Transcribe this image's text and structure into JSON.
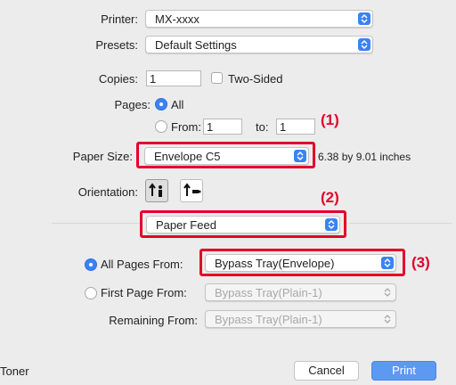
{
  "printer": {
    "label": "Printer:",
    "value": "MX-xxxx"
  },
  "presets": {
    "label": "Presets:",
    "value": "Default Settings"
  },
  "copies": {
    "label": "Copies:",
    "value": "1",
    "two_sided_label": "Two-Sided"
  },
  "pages": {
    "label": "Pages:",
    "all_label": "All",
    "from_label": "From:",
    "from_value": "1",
    "to_label": "to:",
    "to_value": "1"
  },
  "paper_size": {
    "label": "Paper Size:",
    "value": "Envelope C5",
    "dimensions": "6.38 by 9.01 inches"
  },
  "orientation": {
    "label": "Orientation:"
  },
  "section_menu": {
    "value": "Paper Feed"
  },
  "paper_feed": {
    "all_pages_label": "All Pages From:",
    "all_pages_value": "Bypass Tray(Envelope)",
    "first_page_label": "First Page From:",
    "first_page_value": "Bypass Tray(Plain-1)",
    "remaining_label": "Remaining From:",
    "remaining_value": "Bypass Tray(Plain-1)"
  },
  "callouts": {
    "c1": "(1)",
    "c2": "(2)",
    "c3": "(3)"
  },
  "footer": {
    "left_text": "Toner",
    "cancel_label": "Cancel",
    "print_label": "Print"
  },
  "colors": {
    "accent": "#3b82f6",
    "highlight": "#e3002a"
  }
}
